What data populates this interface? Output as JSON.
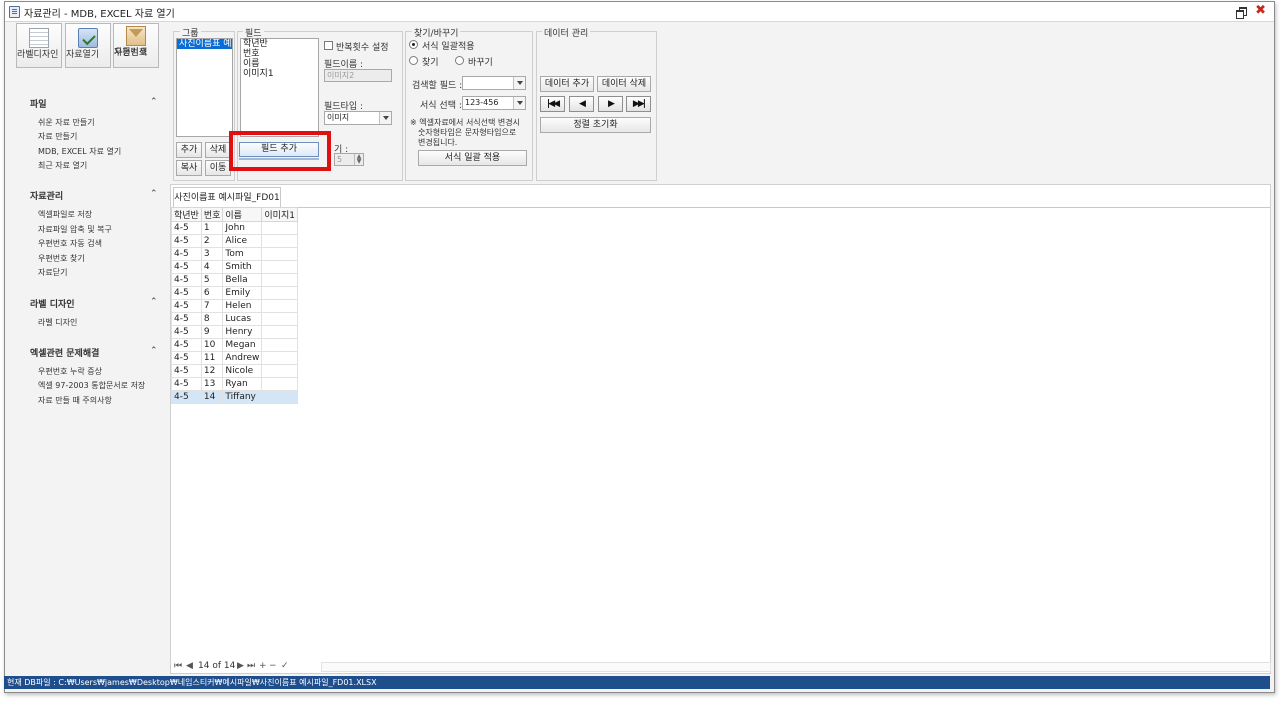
{
  "window": {
    "title": "자료관리 - MDB, EXCEL 자료 열기",
    "close_glyph": "✖"
  },
  "toolbar": {
    "label_design": "라벨디자인",
    "open_data": "자료열기",
    "postal_search": [
      "우편번호",
      "자동검색"
    ]
  },
  "nav": {
    "sections": [
      {
        "title": "파일",
        "items": [
          "쉬운 자료 만들기",
          "자료 만들기",
          "MDB, EXCEL 자료 열기",
          "최근 자료 열기"
        ]
      },
      {
        "title": "자료관리",
        "items": [
          "엑셀파일로 저장",
          "자료파일 압축 및 복구",
          "우편번호 자동 검색",
          "우편번호 찾기",
          "자료닫기"
        ]
      },
      {
        "title": "라벨 디자인",
        "items": [
          "라벨 디자인"
        ]
      },
      {
        "title": "엑셀관련 문제해결",
        "items": [
          "우편번호 누락 증상",
          "엑셀 97-2003 통합문서로 저장",
          "자료 만들 때 주의사항"
        ]
      }
    ],
    "chevron": "⌃"
  },
  "group": {
    "legend": "그룹",
    "selected_item": "사진이름표 예",
    "btn_add": "추가",
    "btn_delete": "삭제",
    "btn_copy": "복사",
    "btn_move": "이동"
  },
  "field": {
    "legend": "필드",
    "items": [
      "학년반",
      "번호",
      "이름",
      "이미지1"
    ],
    "repeat_label": "반복횟수 설정",
    "name_label": "필드이름 :",
    "name_value": "이미지2",
    "type_label": "필드타입 :",
    "type_value": "이미지",
    "size_label": "기 :",
    "size_value": "5",
    "add_button": "필드 추가"
  },
  "find": {
    "legend": "찾기/바꾸기",
    "opt_bulk": "서식 일괄적용",
    "opt_find": "찾기",
    "opt_replace": "바꾸기",
    "search_field_label": "검색할 필드 :",
    "search_field_value": "",
    "format_label": "서식 선택 :",
    "format_value": "123-456",
    "note": [
      "※ 엑셀자료에서 서식선택 변경시",
      "숫자형타입은 문자형타입으로",
      "변경됩니다."
    ],
    "apply_button": "서식 일괄 적용"
  },
  "data_mgmt": {
    "legend": "데이터 관리",
    "add_button": "데이터 추가",
    "delete_button": "데이터 삭제",
    "nav_first": "|◀◀",
    "nav_prev": "◀",
    "nav_next": "▶",
    "nav_last": "▶▶|",
    "sort_reset": "정렬 초기화"
  },
  "document": {
    "tab": "사진이름표 예시파일_FD01",
    "columns": [
      "학년반",
      "번호",
      "이름",
      "이미지1"
    ],
    "rows": [
      [
        "4-5",
        "1",
        "John",
        ""
      ],
      [
        "4-5",
        "2",
        "Alice",
        ""
      ],
      [
        "4-5",
        "3",
        "Tom",
        ""
      ],
      [
        "4-5",
        "4",
        "Smith",
        ""
      ],
      [
        "4-5",
        "5",
        "Bella",
        ""
      ],
      [
        "4-5",
        "6",
        "Emily",
        ""
      ],
      [
        "4-5",
        "7",
        "Helen",
        ""
      ],
      [
        "4-5",
        "8",
        "Lucas",
        ""
      ],
      [
        "4-5",
        "9",
        "Henry",
        ""
      ],
      [
        "4-5",
        "10",
        "Megan",
        ""
      ],
      [
        "4-5",
        "11",
        "Andrew",
        ""
      ],
      [
        "4-5",
        "12",
        "Nicole",
        ""
      ],
      [
        "4-5",
        "13",
        "Ryan",
        ""
      ],
      [
        "4-5",
        "14",
        "Tiffany",
        ""
      ]
    ],
    "selected_row": 13,
    "pager": {
      "first": "⏮",
      "prev": "◀",
      "position": "14 of 14",
      "next": "▶",
      "last": "⏭",
      "add": "+",
      "remove": "−",
      "confirm": "✓"
    }
  },
  "status": {
    "text": "현재 DB파일 : C:₩Users₩james₩Desktop₩네임스티커₩예시파일₩사진이름표 예시파일_FD01.XLSX"
  }
}
